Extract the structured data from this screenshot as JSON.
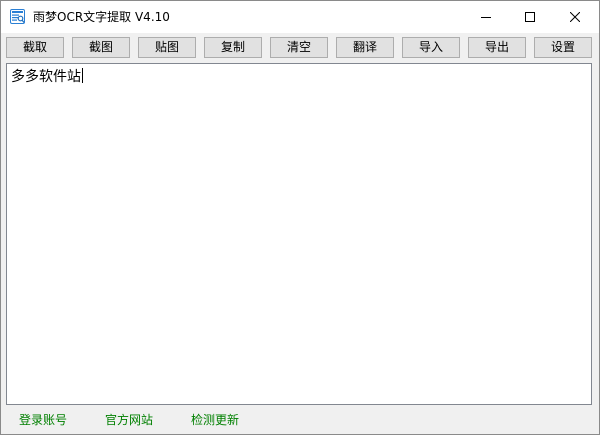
{
  "window": {
    "title": "雨梦OCR文字提取 V4.10",
    "app_icon": "ocr-app-icon",
    "controls": {
      "minimize_icon": "minimize-icon",
      "maximize_icon": "maximize-icon",
      "close_icon": "close-icon"
    }
  },
  "toolbar": {
    "buttons": [
      {
        "label": "截取"
      },
      {
        "label": "截图"
      },
      {
        "label": "贴图"
      },
      {
        "label": "复制"
      },
      {
        "label": "清空"
      },
      {
        "label": "翻译"
      },
      {
        "label": "导入"
      },
      {
        "label": "导出"
      },
      {
        "label": "设置"
      }
    ]
  },
  "editor": {
    "text": "多多软件站"
  },
  "status": {
    "links": [
      {
        "label": "登录账号"
      },
      {
        "label": "官方网站"
      },
      {
        "label": "检测更新"
      }
    ],
    "link_color": "#008000"
  }
}
